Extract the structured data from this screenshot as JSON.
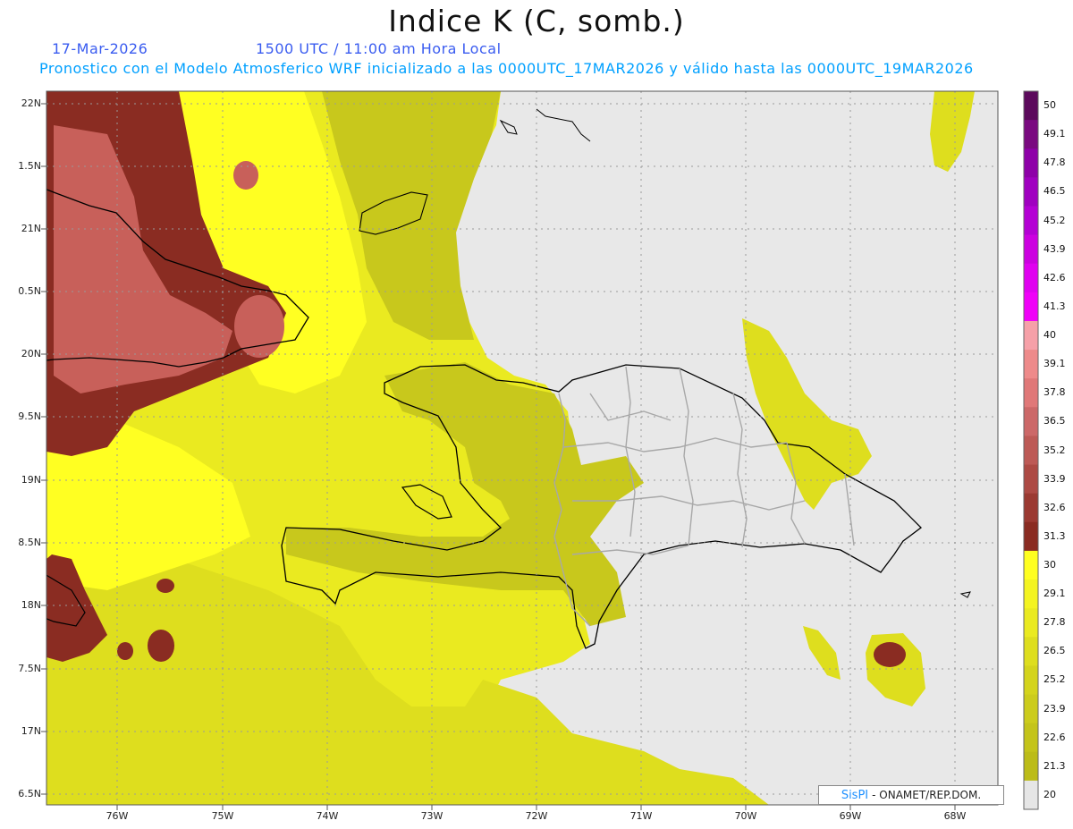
{
  "header": {
    "title": "Indice K (C, somb.)",
    "date": "17-Mar-2026",
    "time": "1500 UTC / 11:00 am Hora Local",
    "description": "Pronostico con el Modelo Atmosferico WRF inicializado a las 0000UTC_17MAR2026 y válido hasta las  0000UTC_19MAR2026"
  },
  "credit": {
    "brand": "SisPI",
    "text": "- ONAMET/REP.DOM."
  },
  "lat_labels": [
    "22N",
    "1.5N",
    "21N",
    "0.5N",
    "20N",
    "9.5N",
    "19N",
    "8.5N",
    "18N",
    "7.5N",
    "17N",
    "6.5N"
  ],
  "lon_labels": [
    "76W",
    "75W",
    "74W",
    "73W",
    "72W",
    "71W",
    "70W",
    "69W",
    "68W"
  ],
  "colorbar": {
    "labels": [
      "50",
      "49.1",
      "47.8",
      "46.5",
      "45.2",
      "43.9",
      "42.6",
      "41.3",
      "40",
      "39.1",
      "37.8",
      "36.5",
      "35.2",
      "33.9",
      "32.6",
      "31.3",
      "30",
      "29.1",
      "27.8",
      "26.5",
      "25.2",
      "23.9",
      "22.6",
      "21.3",
      "20"
    ],
    "colors": [
      "#5c0a5c",
      "#7a0a80",
      "#8e00a8",
      "#a000c0",
      "#b400d4",
      "#cc00e0",
      "#e000f0",
      "#f000f8",
      "#f6a0a8",
      "#ee8a8a",
      "#e07878",
      "#cc6868",
      "#bd5a56",
      "#ad4a44",
      "#9b3a32",
      "#8a2c22",
      "#ffff20",
      "#f4f420",
      "#eaea20",
      "#dede1e",
      "#d4d41c",
      "#cccc1c",
      "#c4c41a",
      "#bcbc18",
      "#e6e6e6"
    ]
  },
  "colors": {
    "background": "#e8e8e8",
    "k_low": "#c8c81c",
    "k_mid": "#e6e622",
    "k_high": "#ffff22",
    "k_brown": "#8a2c22",
    "k_red": "#c8605a",
    "coast": "#000000",
    "border": "#a8a8a8",
    "grid": "#9a9a9a"
  }
}
